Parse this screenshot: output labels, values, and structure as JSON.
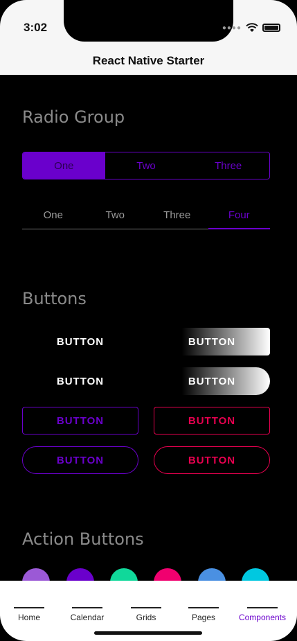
{
  "status_bar": {
    "time": "3:02"
  },
  "header": {
    "title": "React Native Starter"
  },
  "radio_group": {
    "title": "Radio Group",
    "segmented": [
      "One",
      "Two",
      "Three"
    ],
    "segmented_selected": "One",
    "tabs": [
      "One",
      "Two",
      "Three",
      "Four"
    ],
    "tabs_selected": "Four"
  },
  "buttons": {
    "title": "Buttons",
    "plain_1": "BUTTON",
    "gradient_1": "BUTTON",
    "plain_2": "BUTTON",
    "gradient_2": "BUTTON",
    "outline_purple_1": "BUTTON",
    "outline_red_1": "BUTTON",
    "outline_purple_2": "BUTTON",
    "outline_red_2": "BUTTON"
  },
  "action_buttons": {
    "title": "Action Buttons",
    "colors": [
      "#9b59d6",
      "#6a00cc",
      "#10d89a",
      "#f0006f",
      "#4a90e2",
      "#00c8e0"
    ]
  },
  "tab_bar": {
    "items": [
      "Home",
      "Calendar",
      "Grids",
      "Pages",
      "Components"
    ],
    "active": "Components"
  },
  "colors": {
    "accent_purple": "#6a00cc",
    "accent_red": "#e8004f",
    "background": "#000000"
  }
}
